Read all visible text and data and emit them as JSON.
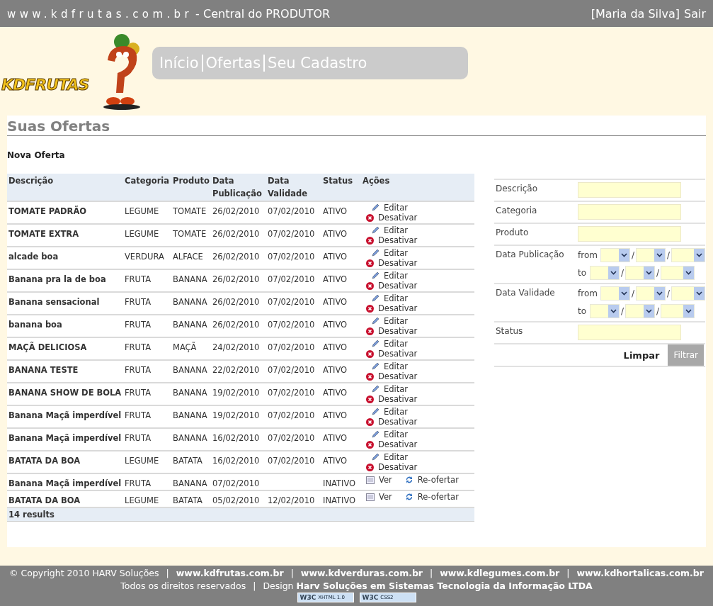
{
  "topbar": {
    "site": "www.kdfrutas.com.br",
    "subtitle": "- Central do PRODUTOR",
    "user": "[Maria da Silva]",
    "logout": "Sair"
  },
  "logo": {
    "text": "KDFRUTAS"
  },
  "nav": [
    {
      "label": "Início"
    },
    {
      "label": "Ofertas"
    },
    {
      "label": "Seu Cadastro"
    }
  ],
  "page_title": "Suas Ofertas",
  "new_link": "Nova Oferta",
  "table": {
    "columns": [
      "Descrição",
      "Categoria",
      "Produto",
      "Data Publicação",
      "Data Validade",
      "Status",
      "Ações"
    ],
    "rows": [
      {
        "description": "TOMATE PADRÃO",
        "category": "LEGUME",
        "product": "TOMATE",
        "published": "26/02/2010",
        "valid": "07/02/2010",
        "status": "ATIVO",
        "actions": [
          {
            "kind": "edit",
            "label": "Editar"
          },
          {
            "kind": "deactivate",
            "label": "Desativar"
          }
        ]
      },
      {
        "description": "TOMATE EXTRA",
        "category": "LEGUME",
        "product": "TOMATE",
        "published": "26/02/2010",
        "valid": "07/02/2010",
        "status": "ATIVO",
        "actions": [
          {
            "kind": "edit",
            "label": "Editar"
          },
          {
            "kind": "deactivate",
            "label": "Desativar"
          }
        ]
      },
      {
        "description": "alcade boa",
        "category": "VERDURA",
        "product": "ALFACE",
        "published": "26/02/2010",
        "valid": "07/02/2010",
        "status": "ATIVO",
        "actions": [
          {
            "kind": "edit",
            "label": "Editar"
          },
          {
            "kind": "deactivate",
            "label": "Desativar"
          }
        ]
      },
      {
        "description": "Banana pra la de boa",
        "category": "FRUTA",
        "product": "BANANA",
        "published": "26/02/2010",
        "valid": "07/02/2010",
        "status": "ATIVO",
        "actions": [
          {
            "kind": "edit",
            "label": "Editar"
          },
          {
            "kind": "deactivate",
            "label": "Desativar"
          }
        ]
      },
      {
        "description": "Banana sensacional",
        "category": "FRUTA",
        "product": "BANANA",
        "published": "26/02/2010",
        "valid": "07/02/2010",
        "status": "ATIVO",
        "actions": [
          {
            "kind": "edit",
            "label": "Editar"
          },
          {
            "kind": "deactivate",
            "label": "Desativar"
          }
        ]
      },
      {
        "description": "banana boa",
        "category": "FRUTA",
        "product": "BANANA",
        "published": "26/02/2010",
        "valid": "07/02/2010",
        "status": "ATIVO",
        "actions": [
          {
            "kind": "edit",
            "label": "Editar"
          },
          {
            "kind": "deactivate",
            "label": "Desativar"
          }
        ]
      },
      {
        "description": "MAÇÃ DELICIOSA",
        "category": "FRUTA",
        "product": "MAÇÃ",
        "published": "24/02/2010",
        "valid": "07/02/2010",
        "status": "ATIVO",
        "actions": [
          {
            "kind": "edit",
            "label": "Editar"
          },
          {
            "kind": "deactivate",
            "label": "Desativar"
          }
        ]
      },
      {
        "description": "BANANA TESTE",
        "category": "FRUTA",
        "product": "BANANA",
        "published": "22/02/2010",
        "valid": "07/02/2010",
        "status": "ATIVO",
        "actions": [
          {
            "kind": "edit",
            "label": "Editar"
          },
          {
            "kind": "deactivate",
            "label": "Desativar"
          }
        ]
      },
      {
        "description": "BANANA SHOW DE BOLA",
        "category": "FRUTA",
        "product": "BANANA",
        "published": "19/02/2010",
        "valid": "07/02/2010",
        "status": "ATIVO",
        "actions": [
          {
            "kind": "edit",
            "label": "Editar"
          },
          {
            "kind": "deactivate",
            "label": "Desativar"
          }
        ]
      },
      {
        "description": "Banana Maçã imperdível",
        "category": "FRUTA",
        "product": "BANANA",
        "published": "19/02/2010",
        "valid": "07/02/2010",
        "status": "ATIVO",
        "actions": [
          {
            "kind": "edit",
            "label": "Editar"
          },
          {
            "kind": "deactivate",
            "label": "Desativar"
          }
        ]
      },
      {
        "description": "Banana Maçã imperdível",
        "category": "FRUTA",
        "product": "BANANA",
        "published": "16/02/2010",
        "valid": "07/02/2010",
        "status": "ATIVO",
        "actions": [
          {
            "kind": "edit",
            "label": "Editar"
          },
          {
            "kind": "deactivate",
            "label": "Desativar"
          }
        ]
      },
      {
        "description": "BATATA DA BOA",
        "category": "LEGUME",
        "product": "BATATA",
        "published": "16/02/2010",
        "valid": "07/02/2010",
        "status": "ATIVO",
        "actions": [
          {
            "kind": "edit",
            "label": "Editar"
          },
          {
            "kind": "deactivate",
            "label": "Desativar"
          }
        ]
      },
      {
        "description": "Banana Maçã imperdível",
        "category": "FRUTA",
        "product": "BANANA",
        "published": "07/02/2010",
        "status": "INATIVO",
        "actions": [
          {
            "kind": "view",
            "label": "Ver"
          },
          {
            "kind": "reoffer",
            "label": "Re-ofertar"
          }
        ]
      },
      {
        "description": "BATATA DA BOA",
        "category": "LEGUME",
        "product": "BATATA",
        "published": "05/02/2010",
        "valid": "12/02/2010",
        "status": "INATIVO",
        "actions": [
          {
            "kind": "view",
            "label": "Ver"
          },
          {
            "kind": "reoffer",
            "label": "Re-ofertar"
          }
        ]
      }
    ],
    "footer": "14 results"
  },
  "filter": {
    "fields": [
      {
        "kind": "text",
        "label": "Descrição"
      },
      {
        "kind": "text",
        "label": "Categoria"
      },
      {
        "kind": "text",
        "label": "Produto"
      },
      {
        "kind": "daterange",
        "label": "Data Publicação",
        "from": "from",
        "to": "to"
      },
      {
        "kind": "daterange",
        "label": "Data Validade",
        "from": "from",
        "to": "to"
      },
      {
        "kind": "text",
        "label": "Status"
      }
    ],
    "date_separator": "/",
    "buttons": [
      {
        "label": "Limpar",
        "disabled": false
      },
      {
        "label": "Filtrar",
        "disabled": true
      }
    ]
  },
  "footer": {
    "separator": "|",
    "copyright": "© Copyright 2010 HARV Soluções",
    "links": [
      "www.kdfrutas.com.br",
      "www.kdverduras.com.br",
      "www.kdlegumes.com.br",
      "www.kdhortalicas.com.br"
    ],
    "rights": "Todos os direitos reservados",
    "design": "Design **Harv Soluções em Sistemas Tecnologia da Informação LTDA**",
    "badges": [
      {
        "brand": "W3C",
        "label": "XHTML 1.0"
      },
      {
        "brand": "W3C",
        "label": "CSS2"
      }
    ]
  }
}
